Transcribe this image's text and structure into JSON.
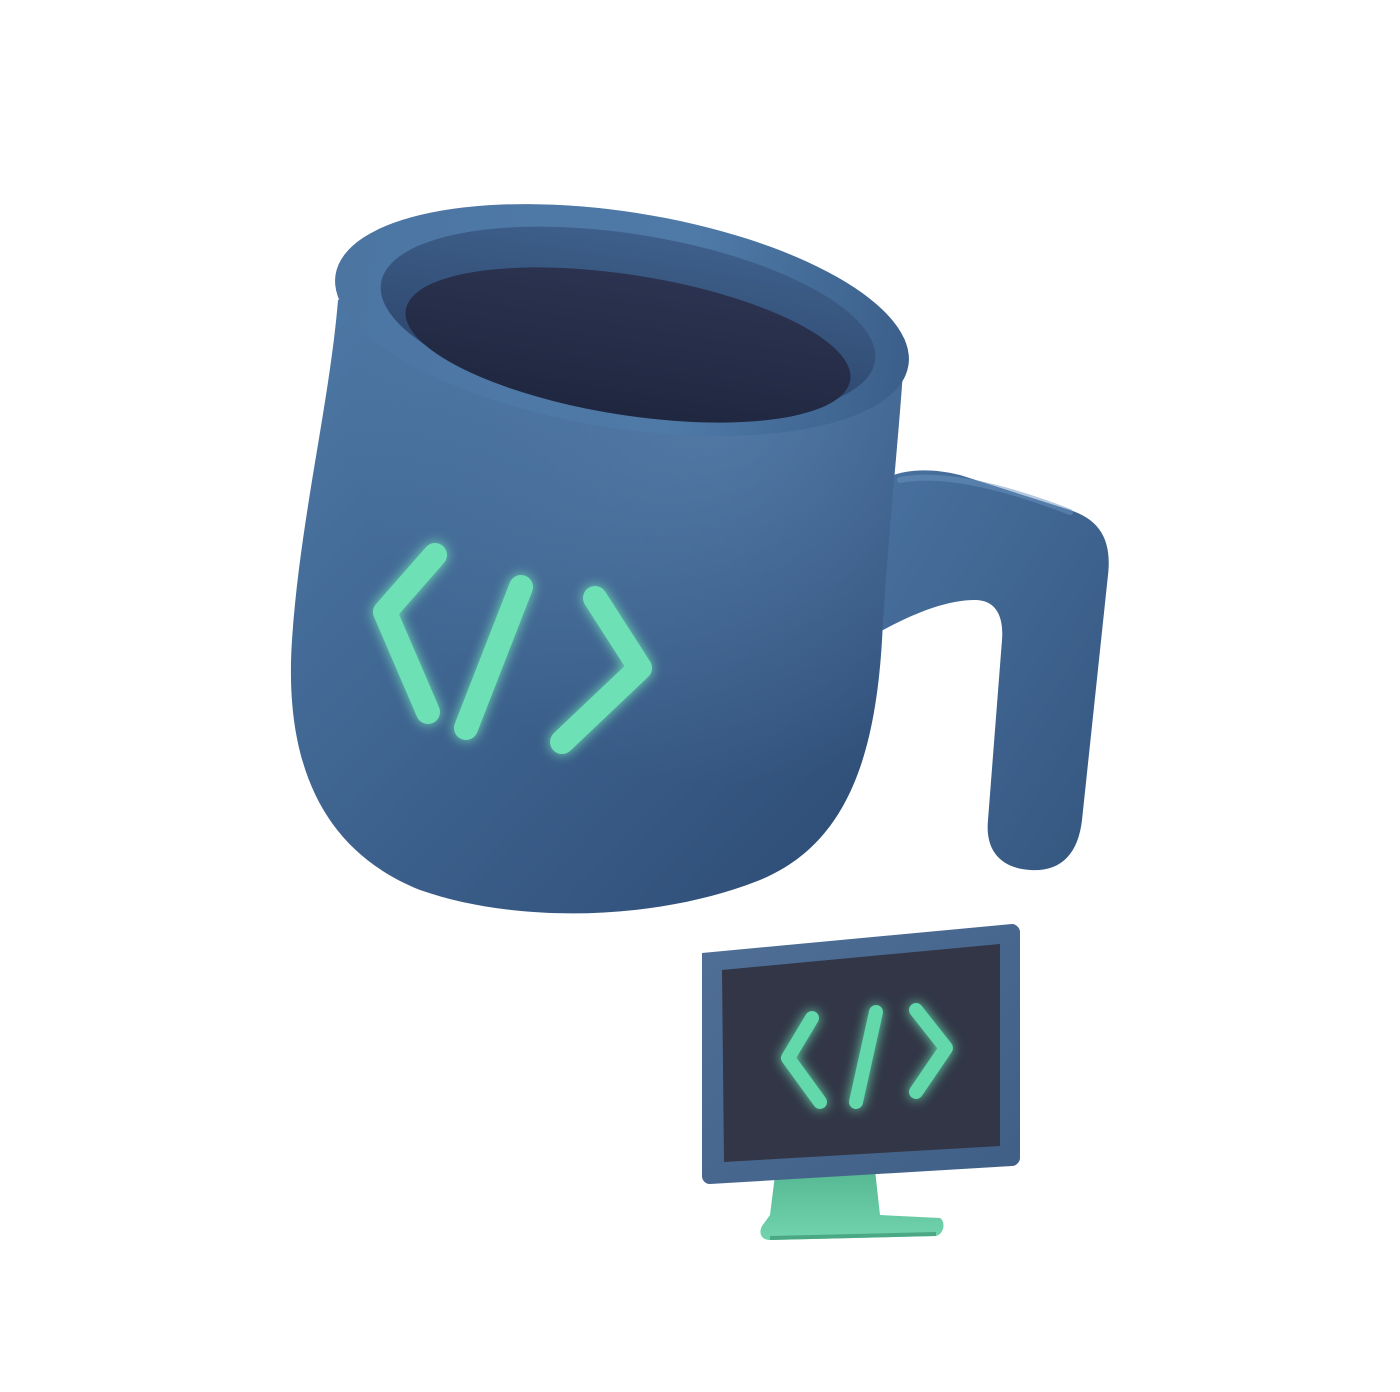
{
  "illustration": {
    "mug": {
      "icon": "code-brackets-icon",
      "body_color": "#3f6592",
      "inner_color": "#232c44",
      "accent_color": "#6ee0b6"
    },
    "monitor": {
      "icon": "code-brackets-icon",
      "frame_color": "#476a92",
      "screen_color": "#323646",
      "stand_color": "#67c9a3",
      "accent_color": "#63d8aa"
    }
  }
}
